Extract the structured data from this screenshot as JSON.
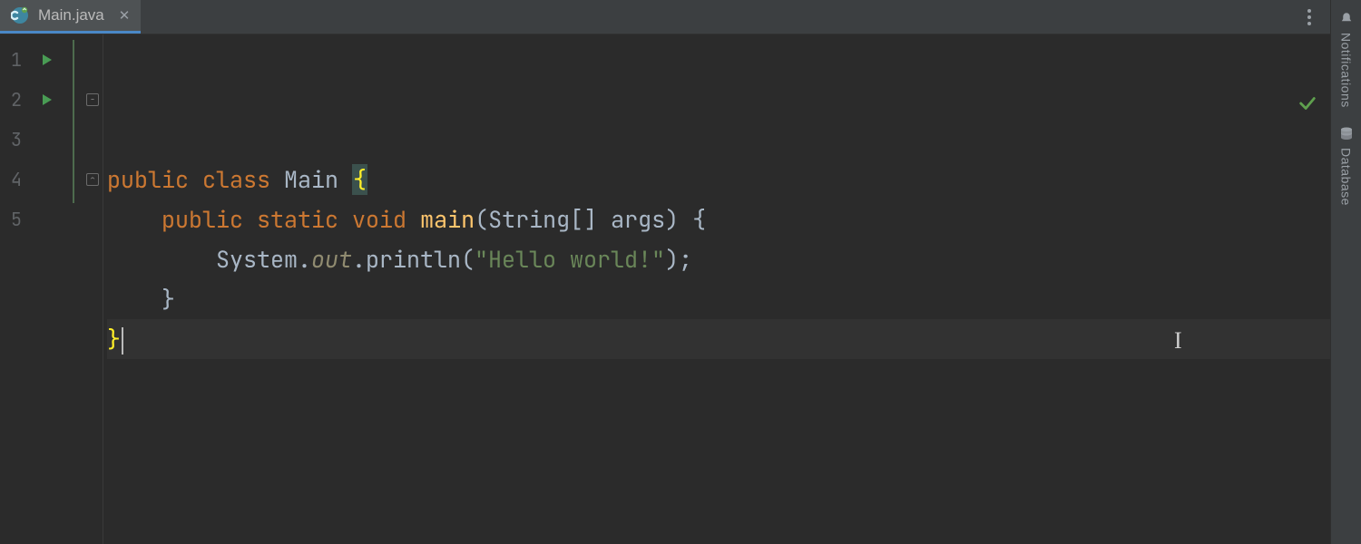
{
  "tab": {
    "filename": "Main.java",
    "icon": "java-class-icon"
  },
  "gutter": {
    "lines": [
      "1",
      "2",
      "3",
      "4",
      "5"
    ],
    "run_markers_on": [
      1,
      2
    ]
  },
  "code": {
    "lines": [
      {
        "tokens": [
          {
            "t": "public ",
            "c": "kw"
          },
          {
            "t": "class ",
            "c": "kw"
          },
          {
            "t": "Main ",
            "c": ""
          },
          {
            "t": "{",
            "c": "br-match"
          }
        ],
        "indent": 0
      },
      {
        "tokens": [
          {
            "t": "public ",
            "c": "kw"
          },
          {
            "t": "static ",
            "c": "kw"
          },
          {
            "t": "void ",
            "c": "kw"
          },
          {
            "t": "main",
            "c": "fn"
          },
          {
            "t": "(String[] args) {",
            "c": ""
          }
        ],
        "indent": 1
      },
      {
        "tokens": [
          {
            "t": "System.",
            "c": ""
          },
          {
            "t": "out",
            "c": "it"
          },
          {
            "t": ".println(",
            "c": ""
          },
          {
            "t": "\"Hello world!\"",
            "c": "str"
          },
          {
            "t": ");",
            "c": ""
          }
        ],
        "indent": 2
      },
      {
        "tokens": [
          {
            "t": "}",
            "c": ""
          }
        ],
        "indent": 1
      },
      {
        "tokens": [
          {
            "t": "}",
            "c": "br-yellow"
          }
        ],
        "indent": 0,
        "current": true,
        "caret": true
      }
    ]
  },
  "status": {
    "ok": true
  },
  "right_rail": {
    "items": [
      {
        "icon": "bell-icon",
        "label": "Notifications"
      },
      {
        "icon": "database-icon",
        "label": "Database"
      }
    ]
  }
}
